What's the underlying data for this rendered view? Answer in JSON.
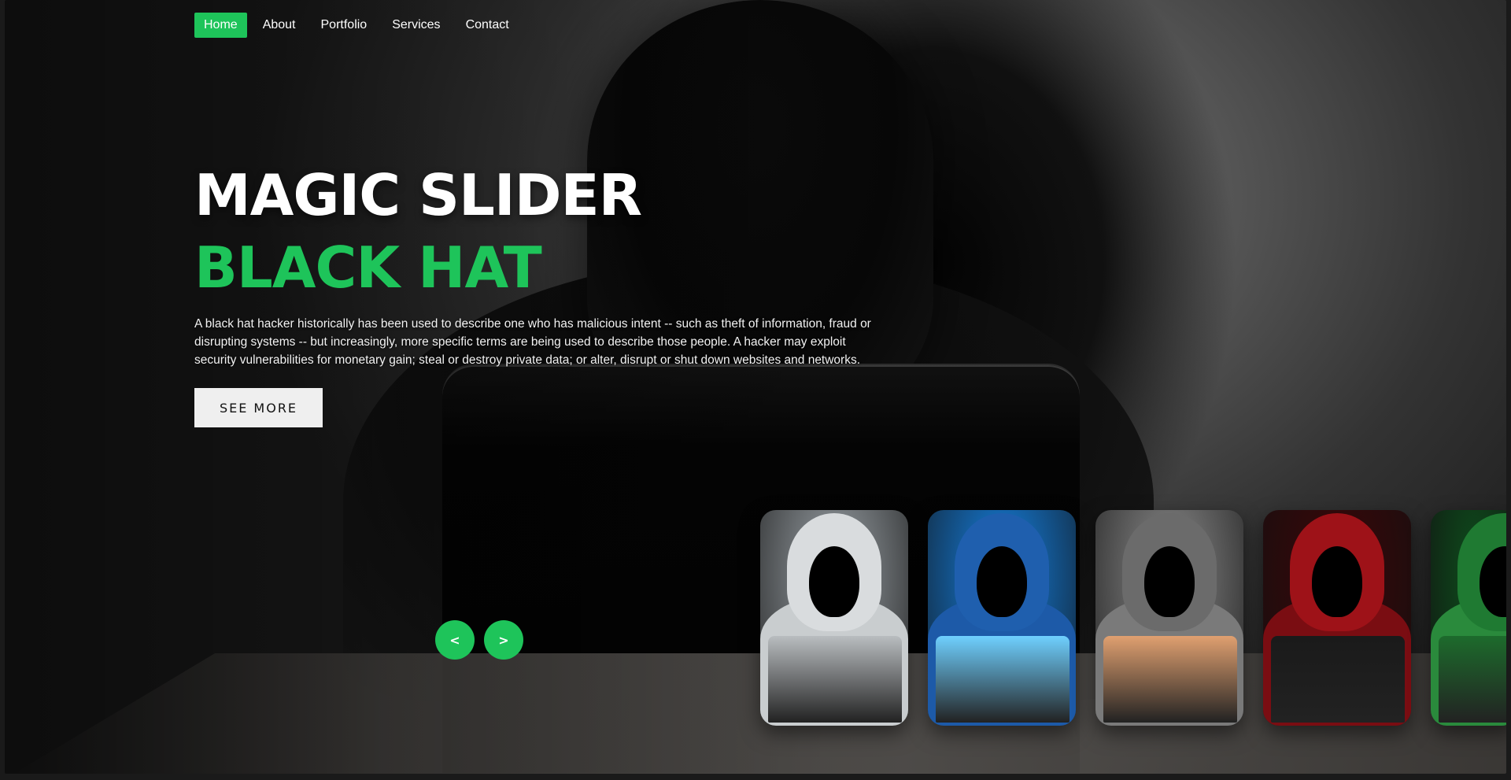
{
  "nav": {
    "items": [
      {
        "label": "Home",
        "active": true
      },
      {
        "label": "About",
        "active": false
      },
      {
        "label": "Portfolio",
        "active": false
      },
      {
        "label": "Services",
        "active": false
      },
      {
        "label": "Contact",
        "active": false
      }
    ]
  },
  "hero": {
    "title": "MAGIC SLIDER",
    "subtitle": "BLACK HAT",
    "description": "A black hat hacker historically has been used to describe one who has malicious intent -- such as theft of information, fraud or disrupting systems -- but increasingly, more specific terms are being used to describe those people. A hacker may exploit security vulnerabilities for monetary gain; steal or destroy private data; or alter, disrupt or shut down websites and networks.",
    "button_label": "SEE MORE"
  },
  "slider": {
    "prev_label": "<",
    "next_label": ">"
  },
  "colors": {
    "accent": "#1ec45a",
    "button_bg": "#efefef"
  },
  "thumbnails": [
    {
      "theme": "white-hoodie",
      "hood": "#d9dcde",
      "body": "#c9cdcf",
      "laptop": "#b9bdc0",
      "bg": "#9aa1a6"
    },
    {
      "theme": "blue-hoodie",
      "hood": "#1f5fae",
      "body": "#1d5aa8",
      "laptop": "#6fd0ff",
      "bg": "#1580e0"
    },
    {
      "theme": "grey-hoodie",
      "hood": "#6b6b6b",
      "body": "#7a7a7a",
      "laptop": "#e0a070",
      "bg": "#8a8a8a"
    },
    {
      "theme": "red-hoodie",
      "hood": "#9e1218",
      "body": "#7a0d12",
      "laptop": "#1a1a1a",
      "bg": "#3a0608"
    },
    {
      "theme": "green-hoodie",
      "hood": "#1f7a32",
      "body": "#2a8a3c",
      "laptop": "#1d6b2c",
      "bg": "#0e4b1c"
    }
  ]
}
